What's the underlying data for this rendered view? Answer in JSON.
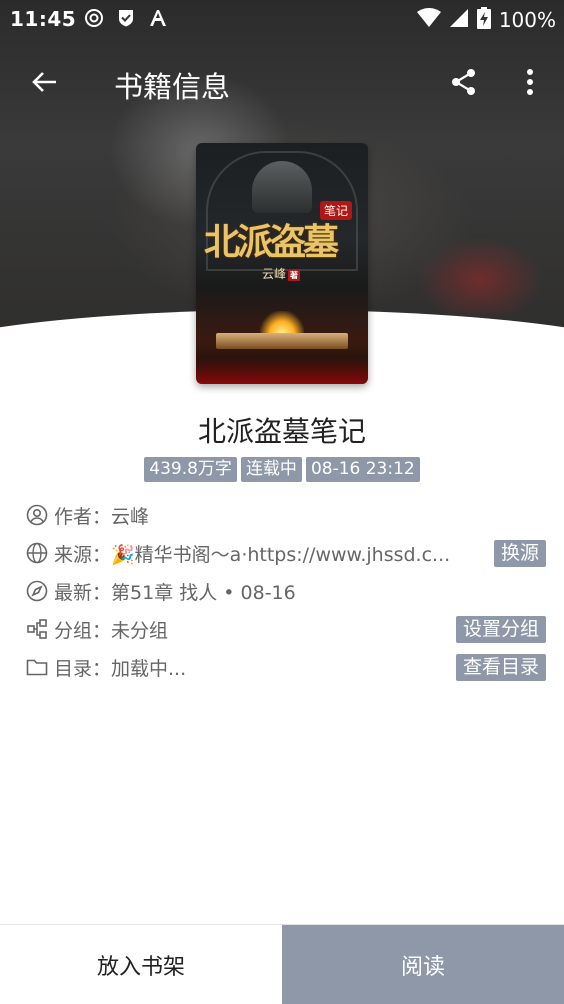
{
  "status_bar": {
    "time": "11:45",
    "battery": "100%",
    "icons": [
      "sync-icon",
      "shield-check-icon",
      "font-a-icon",
      "wifi-icon",
      "signal-icon",
      "battery-charging-icon"
    ]
  },
  "toolbar": {
    "title": "书籍信息",
    "back_icon": "arrow-left-icon",
    "share_icon": "share-icon",
    "more_icon": "more-vertical-icon"
  },
  "cover": {
    "art_title": "北派盗墓",
    "art_seal": "笔记",
    "art_author": "云峰",
    "art_author_mark": "著"
  },
  "book": {
    "title": "北派盗墓笔记",
    "tags": [
      "439.8万字",
      "连载中",
      "08-16 23:12"
    ]
  },
  "info": {
    "author": {
      "label": "作者：",
      "value": "云峰",
      "icon": "user-circle-icon"
    },
    "source": {
      "label": "来源：",
      "value": "🎉精华书阁〜a·https://www.jhssd.c...",
      "icon": "globe-icon",
      "button": "换源"
    },
    "latest": {
      "label": "最新：",
      "value": "第51章 找人 • 08-16",
      "icon": "compass-icon"
    },
    "group": {
      "label": "分组：",
      "value": "未分组",
      "icon": "group-nodes-icon",
      "button": "设置分组"
    },
    "toc": {
      "label": "目录：",
      "value": "加载中...",
      "icon": "folder-icon",
      "button": "查看目录"
    }
  },
  "bottom": {
    "add_shelf": "放入书架",
    "read": "阅读"
  },
  "colors": {
    "accent": "#8e98a8",
    "text": "#222222",
    "secondary_text": "#666666"
  }
}
